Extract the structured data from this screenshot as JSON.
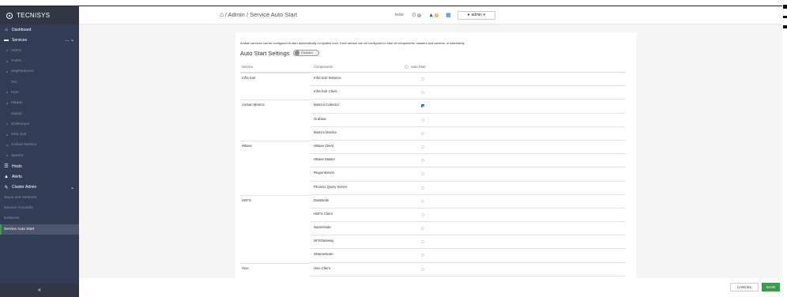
{
  "brand": {
    "name": "TECNISYS"
  },
  "sidebar": {
    "nav": [
      {
        "label": "Dashboard",
        "icon": "home-icon"
      },
      {
        "label": "Services",
        "icon": "services-icon"
      }
    ],
    "services": [
      "HDFS",
      "YARN",
      "MapReduce2",
      "Tez",
      "Hive",
      "HBase",
      "Sqoop",
      "ZooKeeper",
      "Infra Solr",
      "Ambari Metrics",
      "Spark2"
    ],
    "hosts": "Hosts",
    "alerts": "Alerts",
    "cluster_admin": "Cluster Admin",
    "admin_items": [
      "Stack and Versions",
      "Service Accounts",
      "Kerberos",
      "Service Auto Start"
    ],
    "collapse": "«"
  },
  "header": {
    "breadcrumb": "/ Admin / Service Auto Start",
    "cluster": "teste",
    "ops_count": "0",
    "alerts_count": "4",
    "user_menu": "admin ▾"
  },
  "panel": {
    "description": "Ambari services can be configured to start automatically on system boot. Each service can be configured to start all components, masters and workers, or selectively.",
    "title": "Auto Start Settings",
    "toggle": "Disabled",
    "columns": {
      "service": "Service",
      "components": "Components",
      "auto_start": "Auto Start"
    },
    "rows": [
      {
        "service": "Infra Solr",
        "component": "Infra Solr Instance",
        "checked": false
      },
      {
        "service": "",
        "component": "Infra Solr Client",
        "checked": false
      },
      {
        "service": "Ambari Metrics",
        "component": "Metrics Collector",
        "checked": true
      },
      {
        "service": "",
        "component": "Grafana",
        "checked": false
      },
      {
        "service": "",
        "component": "Metrics Monitor",
        "checked": false
      },
      {
        "service": "HBase",
        "component": "HBase Client",
        "checked": false
      },
      {
        "service": "",
        "component": "HBase Master",
        "checked": false
      },
      {
        "service": "",
        "component": "RegionServer",
        "checked": false
      },
      {
        "service": "",
        "component": "Phoenix Query Server",
        "checked": false
      },
      {
        "service": "HDFS",
        "component": "DataNode",
        "checked": false
      },
      {
        "service": "",
        "component": "HDFS Client",
        "checked": false
      },
      {
        "service": "",
        "component": "NameNode",
        "checked": false
      },
      {
        "service": "",
        "component": "NFSGateway",
        "checked": false
      },
      {
        "service": "",
        "component": "SNameNode",
        "checked": false
      },
      {
        "service": "Hive",
        "component": "Hive Client",
        "checked": false
      }
    ]
  },
  "footer": {
    "cancel": "CANCEL",
    "save": "SAVE"
  },
  "colors": {
    "sidebar": "#313d54",
    "accent_green": "#3c9a4b",
    "accent_blue": "#1f73ad"
  }
}
